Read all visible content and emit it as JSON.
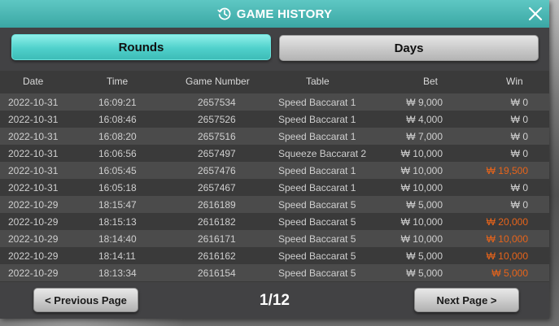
{
  "window": {
    "title": "GAME HISTORY",
    "close_icon": "close-icon",
    "history_icon": "history-clock-icon"
  },
  "tabs": [
    {
      "label": "Rounds",
      "active": true
    },
    {
      "label": "Days",
      "active": false
    }
  ],
  "table": {
    "headers": [
      "Date",
      "Time",
      "Game Number",
      "Table",
      "Bet",
      "Win"
    ],
    "rows": [
      {
        "date": "2022-10-31",
        "time": "16:09:21",
        "game": "2657534",
        "table": "Speed Baccarat 1",
        "bet": "₩ 9,000",
        "win": "₩ 0",
        "won": false
      },
      {
        "date": "2022-10-31",
        "time": "16:08:46",
        "game": "2657526",
        "table": "Speed Baccarat 1",
        "bet": "₩ 4,000",
        "win": "₩ 0",
        "won": false
      },
      {
        "date": "2022-10-31",
        "time": "16:08:20",
        "game": "2657516",
        "table": "Speed Baccarat 1",
        "bet": "₩ 7,000",
        "win": "₩ 0",
        "won": false
      },
      {
        "date": "2022-10-31",
        "time": "16:06:56",
        "game": "2657497",
        "table": "Squeeze Baccarat 2",
        "bet": "₩ 10,000",
        "win": "₩ 0",
        "won": false
      },
      {
        "date": "2022-10-31",
        "time": "16:05:45",
        "game": "2657476",
        "table": "Speed Baccarat 1",
        "bet": "₩ 10,000",
        "win": "₩ 19,500",
        "won": true
      },
      {
        "date": "2022-10-31",
        "time": "16:05:18",
        "game": "2657467",
        "table": "Speed Baccarat 1",
        "bet": "₩ 10,000",
        "win": "₩ 0",
        "won": false
      },
      {
        "date": "2022-10-29",
        "time": "18:15:47",
        "game": "2616189",
        "table": "Speed Baccarat 5",
        "bet": "₩ 5,000",
        "win": "₩ 0",
        "won": false
      },
      {
        "date": "2022-10-29",
        "time": "18:15:13",
        "game": "2616182",
        "table": "Speed Baccarat 5",
        "bet": "₩ 10,000",
        "win": "₩ 20,000",
        "won": true
      },
      {
        "date": "2022-10-29",
        "time": "18:14:40",
        "game": "2616171",
        "table": "Speed Baccarat 5",
        "bet": "₩ 10,000",
        "win": "₩ 10,000",
        "won": true
      },
      {
        "date": "2022-10-29",
        "time": "18:14:11",
        "game": "2616162",
        "table": "Speed Baccarat 5",
        "bet": "₩ 5,000",
        "win": "₩ 10,000",
        "won": true
      },
      {
        "date": "2022-10-29",
        "time": "18:13:34",
        "game": "2616154",
        "table": "Speed Baccarat 5",
        "bet": "₩ 5,000",
        "win": "₩ 5,000",
        "won": true
      }
    ]
  },
  "pagination": {
    "prev_label": "< Previous Page",
    "next_label": "Next Page >",
    "indicator": "1/12"
  },
  "colors": {
    "accent": "#4fd0cb",
    "win_highlight": "#e8641a"
  }
}
